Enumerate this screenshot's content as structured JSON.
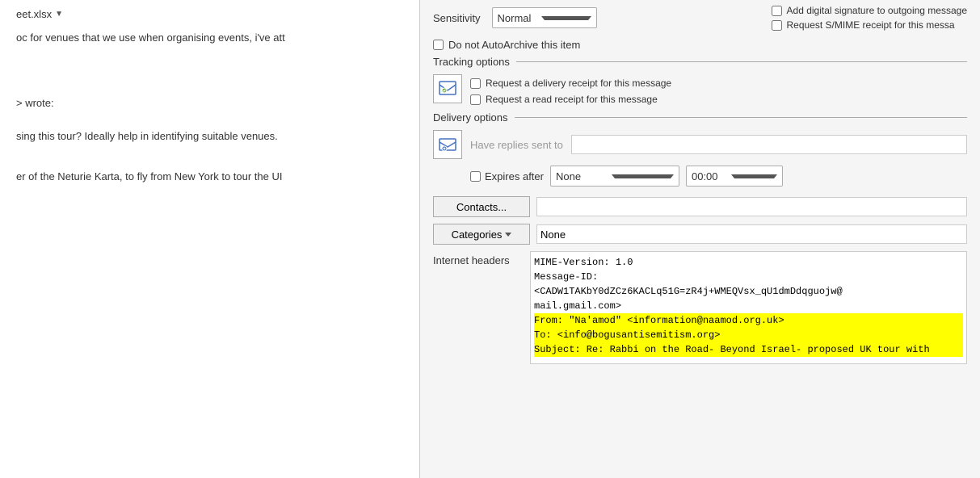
{
  "left_panel": {
    "filename": "eet.xlsx",
    "line1": "oc for venues that we use when organising events, i've att",
    "wrote_line": "> wrote:",
    "body1": "sing this tour?  Ideally help in identifying suitable venues.",
    "body2": "er of the Neturie Karta, to fly from New York to tour the UI"
  },
  "right_panel": {
    "sensitivity": {
      "label": "Sensitivity",
      "value": "Normal"
    },
    "digital_signature": {
      "label": "Add digital signature to outgoing message",
      "checked": false
    },
    "smime_receipt": {
      "label": "Request S/MIME receipt for this messa",
      "checked": false
    },
    "autoarchive": {
      "label": "Do not AutoArchive this item",
      "checked": false
    },
    "tracking_section": {
      "title": "Tracking options",
      "delivery_receipt": {
        "label": "Request a delivery receipt for this message",
        "checked": false
      },
      "read_receipt": {
        "label": "Request a read receipt for this message",
        "checked": false
      }
    },
    "delivery_section": {
      "title": "Delivery options",
      "replies_label": "Have replies sent to",
      "replies_value": "",
      "expires_label": "Expires after",
      "expires_value": "None",
      "time_value": "00:00"
    },
    "contacts": {
      "button_label": "Contacts...",
      "value": ""
    },
    "categories": {
      "button_label": "Categories",
      "value": "None"
    },
    "internet_headers": {
      "label": "Internet headers",
      "lines": [
        {
          "text": "MIME-Version: 1.0",
          "highlight": false
        },
        {
          "text": "Message-ID:",
          "highlight": false
        },
        {
          "text": "<CADW1TAKbY0dZCz6KACLq51G=zR4j+WMEQVsx_qU1dmDdqguojw@",
          "highlight": false
        },
        {
          "text": "mail.gmail.com>",
          "highlight": false
        },
        {
          "text": "From: \"Na'amod\" <information@naamod.org.uk>",
          "highlight": true
        },
        {
          "text": "To: <info@bogusantisemitism.org>",
          "highlight": true
        },
        {
          "text": "Subject: Re: Rabbi on the Road- Beyond Israel- proposed UK tour with",
          "highlight": true
        }
      ]
    }
  }
}
